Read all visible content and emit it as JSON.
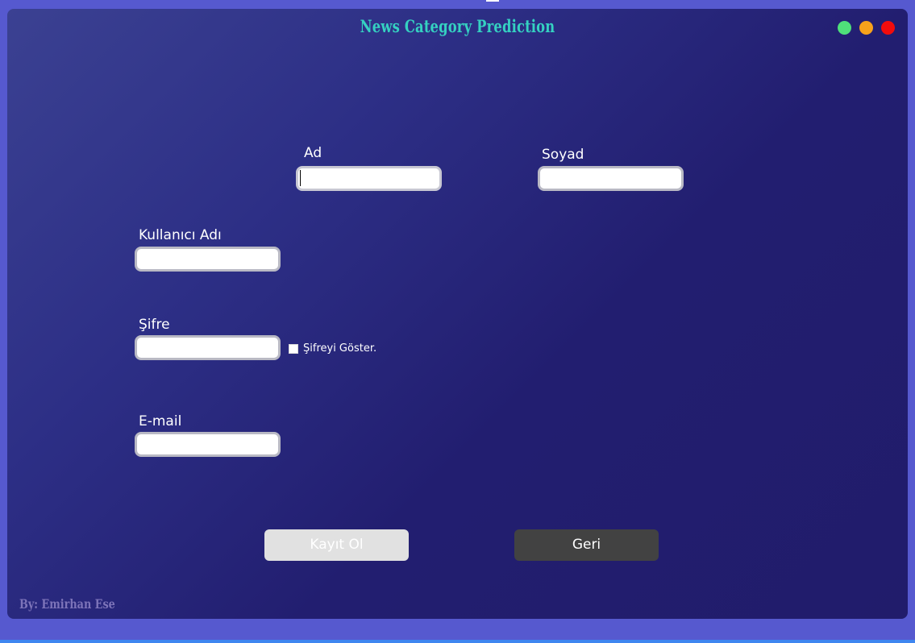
{
  "window": {
    "title": "News Category Prediction",
    "controls": [
      "minimize-dot",
      "maximize-dot",
      "close-dot"
    ],
    "control_colors": {
      "green": "#4fe07a",
      "orange": "#f7a21b",
      "red": "#f20c0c"
    }
  },
  "form": {
    "first_name": {
      "label": "Ad",
      "value": ""
    },
    "last_name": {
      "label": "Soyad",
      "value": ""
    },
    "username": {
      "label": "Kullanıcı Adı",
      "value": ""
    },
    "password": {
      "label": "Şifre",
      "value": ""
    },
    "show_password": {
      "label": "Şifreyi Göster.",
      "checked": false
    },
    "email": {
      "label": "E-mail",
      "value": ""
    }
  },
  "buttons": {
    "register": "Kayıt Ol",
    "back": "Geri"
  },
  "footer": {
    "credit": "By: Emirhan Ese"
  },
  "colors": {
    "title": "#35d1c1",
    "background_outer": "#5659cf",
    "register_button": "#e1e1e1",
    "back_button": "#424242"
  }
}
